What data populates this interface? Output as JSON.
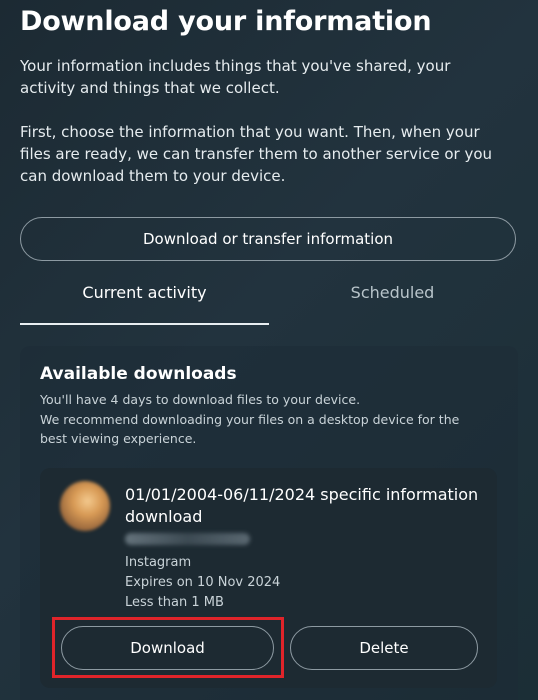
{
  "page": {
    "title": "Download your information",
    "intro_p1": "Your information includes things that you've shared, your activity and things that we collect.",
    "intro_p2": "First, choose the information that you want. Then, when your files are ready, we can transfer them to another service or you can download them to your device.",
    "transfer_button": "Download or transfer information"
  },
  "tabs": [
    {
      "label": "Current activity",
      "active": true
    },
    {
      "label": "Scheduled",
      "active": false
    }
  ],
  "available": {
    "title": "Available downloads",
    "desc_lines": [
      "You'll have 4 days to download files to your device.",
      "We recommend downloading your files on a desktop device for the",
      "best viewing experience."
    ]
  },
  "download_card": {
    "title": "01/01/2004-06/11/2024 specific information download",
    "source": "Instagram",
    "expires": "Expires on 10 Nov 2024",
    "size": "Less than 1 MB",
    "download_label": "Download",
    "delete_label": "Delete"
  },
  "colors": {
    "highlight": "#e0242a",
    "card_bg": "#1d2a32"
  }
}
